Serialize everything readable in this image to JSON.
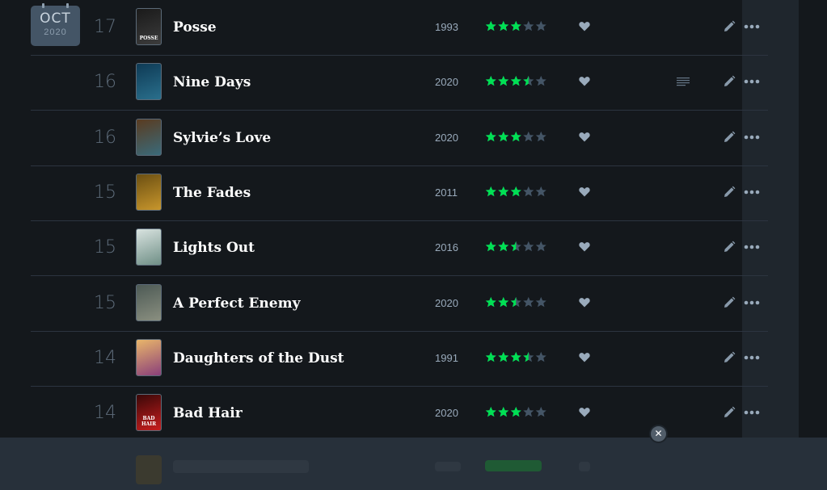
{
  "calendar": {
    "month": "OCT",
    "year": "2020"
  },
  "entries": [
    {
      "day": "17",
      "title": "Posse",
      "year": "1993",
      "rating": 3,
      "poster_colors": [
        "#1a1a1a",
        "#3c3c3c"
      ],
      "poster_text": "POSSE",
      "has_review": false
    },
    {
      "day": "16",
      "title": "Nine Days",
      "year": "2020",
      "rating": 3.5,
      "poster_colors": [
        "#0e3a55",
        "#2a6f8c"
      ],
      "poster_text": "",
      "has_review": true
    },
    {
      "day": "16",
      "title": "Sylvie’s Love",
      "year": "2020",
      "rating": 3,
      "poster_colors": [
        "#5a3b20",
        "#3a6a7a"
      ],
      "poster_text": "",
      "has_review": false
    },
    {
      "day": "15",
      "title": "The Fades",
      "year": "2011",
      "rating": 3,
      "poster_colors": [
        "#6b4f12",
        "#c8962c"
      ],
      "poster_text": "",
      "has_review": false
    },
    {
      "day": "15",
      "title": "Lights Out",
      "year": "2016",
      "rating": 2.5,
      "poster_colors": [
        "#d9e3e0",
        "#6f8f86"
      ],
      "poster_text": "",
      "has_review": false
    },
    {
      "day": "15",
      "title": "A Perfect Enemy",
      "year": "2020",
      "rating": 2.5,
      "poster_colors": [
        "#4d5a55",
        "#8a8f80"
      ],
      "poster_text": "",
      "has_review": false
    },
    {
      "day": "14",
      "title": "Daughters of the Dust",
      "year": "1991",
      "rating": 3.5,
      "poster_colors": [
        "#e9b66a",
        "#8a3f7a"
      ],
      "poster_text": "",
      "has_review": false
    },
    {
      "day": "14",
      "title": "Bad Hair",
      "year": "2020",
      "rating": 3,
      "poster_colors": [
        "#3a0808",
        "#c91e1e"
      ],
      "poster_text": "BAD HAIR",
      "has_review": false
    }
  ],
  "colors": {
    "star_on": "#00e054",
    "star_off": "#456",
    "heart": "#9ab",
    "divider": "#2c3440"
  },
  "icons": {
    "heart": "heart-icon",
    "edit": "pencil-icon",
    "more": "ellipsis-icon",
    "review": "review-lines-icon",
    "close": "close-icon"
  },
  "close_glyph": "✕"
}
